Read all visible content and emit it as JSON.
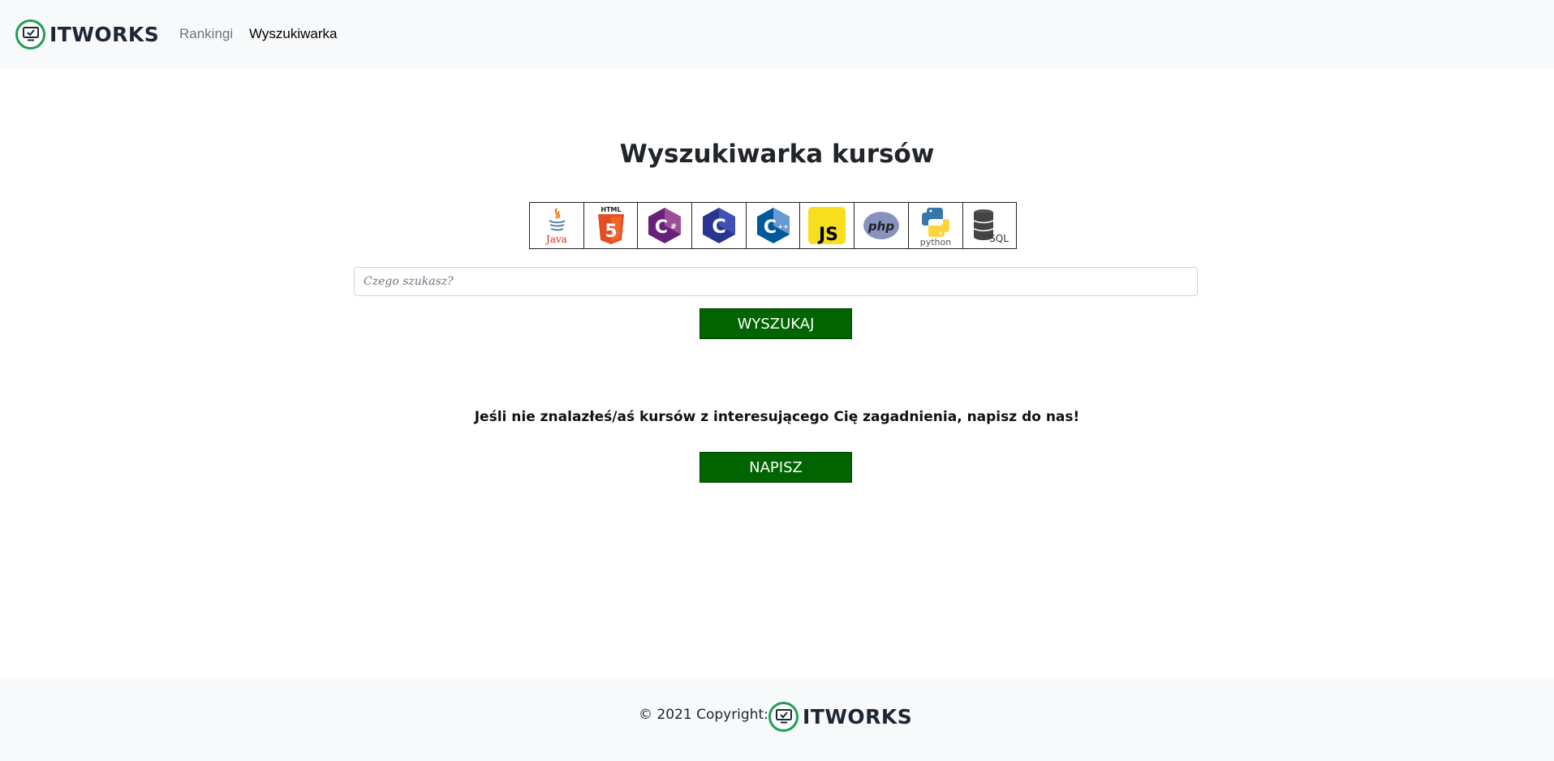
{
  "nav": {
    "brand": "ITWORKS",
    "links": [
      "Rankingi",
      "Wyszukiwarka"
    ]
  },
  "main": {
    "title": "Wyszukiwarka kursów",
    "languages": [
      {
        "name": "Java",
        "label": "Java",
        "icon": "java-icon"
      },
      {
        "name": "HTML5",
        "label": "HTML",
        "icon": "html5-icon"
      },
      {
        "name": "C#",
        "label": "C#",
        "icon": "csharp-icon"
      },
      {
        "name": "C",
        "label": "C",
        "icon": "c-icon"
      },
      {
        "name": "C++",
        "label": "C++",
        "icon": "cpp-icon"
      },
      {
        "name": "JavaScript",
        "label": "JS",
        "icon": "javascript-icon"
      },
      {
        "name": "PHP",
        "label": "php",
        "icon": "php-icon"
      },
      {
        "name": "Python",
        "label": "python",
        "icon": "python-icon"
      },
      {
        "name": "SQL",
        "label": "SQL",
        "icon": "sql-icon"
      }
    ],
    "search_placeholder": "Czego szukasz?",
    "search_button": "WYSZUKAJ",
    "info_text": "Jeśli nie znalazłeś/aś kursów z interesującego Cię zagadnienia, napisz do nas!",
    "write_button": "NAPISZ"
  },
  "footer": {
    "copyright": "© 2021 Copyright:",
    "brand": "ITWORKS"
  },
  "colors": {
    "accent_green": "#006400",
    "logo_green": "#1f9d55",
    "navbar_bg": "#f8f9fa"
  }
}
